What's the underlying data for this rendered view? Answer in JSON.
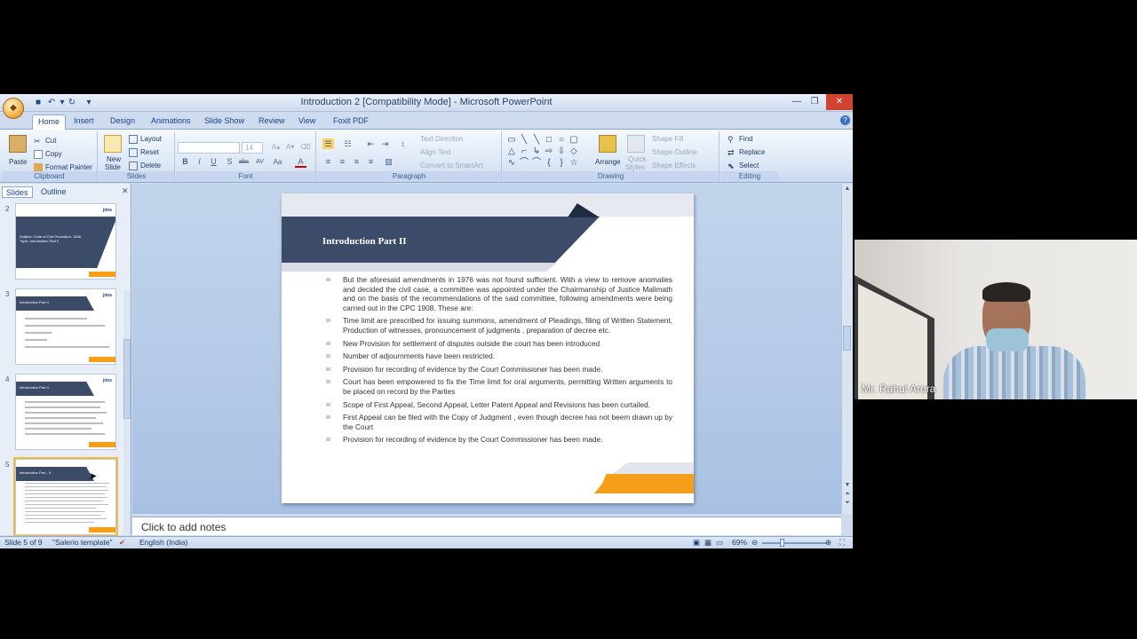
{
  "window": {
    "title": "Introduction 2 [Compatibility Mode] - Microsoft PowerPoint",
    "minimize_icon": "minimize-icon",
    "restore_icon": "restore-icon",
    "close_icon": "close-icon"
  },
  "tabs": [
    "Home",
    "Insert",
    "Design",
    "Animations",
    "Slide Show",
    "Review",
    "View",
    "Foxit PDF"
  ],
  "ribbon": {
    "clipboard": {
      "paste": "Paste",
      "cut": "Cut",
      "copy": "Copy",
      "format_painter": "Format Painter",
      "label": "Clipboard"
    },
    "slides": {
      "new_slide_1": "New",
      "new_slide_2": "Slide",
      "layout": "Layout",
      "reset": "Reset",
      "delete": "Delete",
      "label": "Slides"
    },
    "font": {
      "size": "14",
      "label": "Font",
      "buttons": [
        "B",
        "I",
        "U",
        "S",
        "abc",
        "AV",
        "Aa",
        "A"
      ]
    },
    "paragraph": {
      "text_direction": "Text Direction",
      "align_text": "Align Text",
      "convert_smartart": "Convert to SmartArt",
      "label": "Paragraph"
    },
    "drawing": {
      "arrange": "Arrange",
      "quick_styles_1": "Quick",
      "quick_styles_2": "Styles",
      "shape_fill": "Shape Fill",
      "shape_outline": "Shape Outline",
      "shape_effects": "Shape Effects",
      "label": "Drawing"
    },
    "editing": {
      "find": "Find",
      "replace": "Replace",
      "select": "Select",
      "label": "Editing"
    }
  },
  "pane": {
    "tab_slides": "Slides",
    "tab_outline": "Outline",
    "thumbs": [
      {
        "num": "2",
        "title": "Subject: Code of Civil Procedure, 1908 Topic: Introduction Part II"
      },
      {
        "num": "3",
        "title": "Introduction Part II"
      },
      {
        "num": "4",
        "title": "Introduction Part II"
      },
      {
        "num": "5",
        "title": "Introduction Part - II"
      }
    ],
    "logo": "jims"
  },
  "slide": {
    "title": "Introduction Part II",
    "bullets": [
      "But the aforesaid amendments in 1976 was not found sufficient. With a view to remove anomalies and decided the civil case, a committee was appointed under the Chairmanship of Justice Malimath and on the basis of the recommendations of the said committee, following amendments were being carried out in the CPC 1908. These are:",
      "Time limit are prescribed for issuing summons, amendment of Pleadings, filing of Written Statement, Production of witnesses, pronouncement of judgments , preparation of decree etc.",
      "New Provision for settlement of disputes outside the court has been introduced",
      "Number of adjournments have been restricted.",
      "Provision for recording of evidence by the Court Commissioner has been made.",
      "Court has been empowered to fix the Time limit for oral arguments, permitting Written arguments to be placed on record by the Parties",
      "Scope of First Appeal, Second  Appeal, Letter Patent Appeal and Revisions has been curtailed.",
      "First Appeal can be filed with the Copy of Judgment , even though decree has not beem drawn up by the Court",
      "Provision for recording of evidence by the Court Commissioner has been made."
    ]
  },
  "notes": {
    "placeholder": "Click to add notes"
  },
  "status": {
    "slide_info": "Slide 5 of 9",
    "theme": "\"Salerio template\"",
    "language": "English (India)",
    "zoom": "69%"
  },
  "webcam": {
    "name": "Mr. Rahul Arora"
  }
}
